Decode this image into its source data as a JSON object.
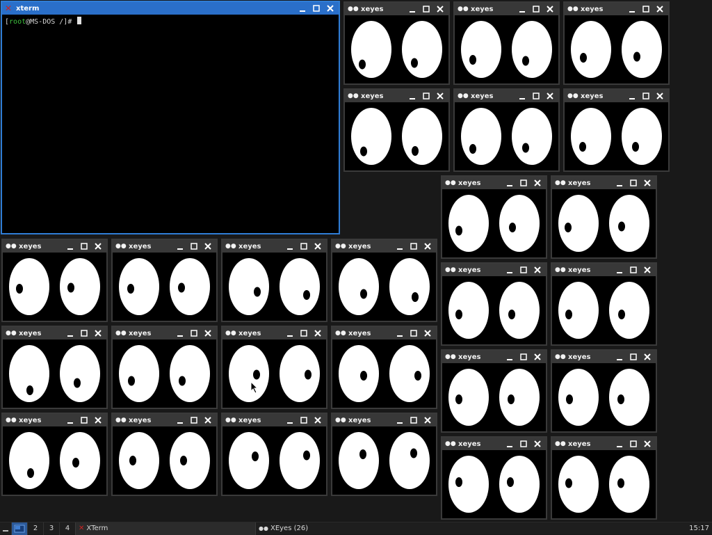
{
  "xterm": {
    "title": "xterm",
    "prompt_open": "[",
    "prompt_user": "root",
    "prompt_rest": "@MS-DOS /]# "
  },
  "xeyes": {
    "title": "xeyes",
    "instances": [
      {
        "lp": [
          -0.65,
          0.72
        ],
        "rp": [
          -0.55,
          0.65
        ]
      },
      {
        "lp": [
          -0.6,
          0.5
        ],
        "rp": [
          -0.45,
          0.55
        ]
      },
      {
        "lp": [
          -0.55,
          0.4
        ],
        "rp": [
          -0.35,
          0.35
        ]
      },
      {
        "lp": [
          -0.55,
          0.72
        ],
        "rp": [
          -0.5,
          0.7
        ]
      },
      {
        "lp": [
          -0.6,
          0.6
        ],
        "rp": [
          -0.45,
          0.55
        ]
      },
      {
        "lp": [
          -0.6,
          0.5
        ],
        "rp": [
          -0.45,
          0.5
        ]
      },
      {
        "lp": [
          -0.7,
          0.35
        ],
        "rp": [
          -0.5,
          0.2
        ]
      },
      {
        "lp": [
          -0.75,
          0.2
        ],
        "rp": [
          -0.55,
          0.15
        ]
      },
      {
        "lp": [
          -0.7,
          0.2
        ],
        "rp": [
          -0.55,
          0.2
        ]
      },
      {
        "lp": [
          -0.7,
          0.2
        ],
        "rp": [
          -0.55,
          0.2
        ]
      },
      {
        "lp": [
          -0.7,
          0.1
        ],
        "rp": [
          -0.6,
          0.1
        ]
      },
      {
        "lp": [
          -0.65,
          0.1
        ],
        "rp": [
          -0.6,
          0.1
        ]
      },
      {
        "lp": [
          -0.7,
          -0.1
        ],
        "rp": [
          -0.65,
          -0.1
        ]
      },
      {
        "lp": [
          -0.7,
          -0.05
        ],
        "rp": [
          -0.6,
          -0.05
        ]
      },
      {
        "lp": [
          -0.7,
          0.1
        ],
        "rp": [
          -0.65,
          0.05
        ]
      },
      {
        "lp": [
          -0.6,
          0.1
        ],
        "rp": [
          -0.6,
          0.05
        ]
      },
      {
        "lp": [
          0.6,
          0.25
        ],
        "rp": [
          0.5,
          0.4
        ]
      },
      {
        "lp": [
          0.35,
          0.35
        ],
        "rp": [
          0.4,
          0.5
        ]
      },
      {
        "lp": [
          0.05,
          0.8
        ],
        "rp": [
          -0.2,
          0.45
        ]
      },
      {
        "lp": [
          -0.55,
          0.35
        ],
        "rp": [
          -0.55,
          0.35
        ]
      },
      {
        "lp": [
          0.55,
          0.05
        ],
        "rp": [
          0.6,
          0.05
        ]
      },
      {
        "lp": [
          0.35,
          0.1
        ],
        "rp": [
          0.6,
          0.1
        ]
      },
      {
        "lp": [
          0.1,
          0.6
        ],
        "rp": [
          -0.3,
          0.1
        ]
      },
      {
        "lp": [
          -0.45,
          0.0
        ],
        "rp": [
          -0.45,
          0.0
        ]
      },
      {
        "lp": [
          0.45,
          -0.2
        ],
        "rp": [
          0.5,
          -0.25
        ]
      },
      {
        "lp": [
          0.3,
          -0.3
        ],
        "rp": [
          0.3,
          -0.35
        ]
      }
    ]
  },
  "taskbar": {
    "workspaces": [
      "",
      "2",
      "3",
      "4"
    ],
    "task_xterm": "XTerm",
    "task_xeyes": "XEyes (26)",
    "clock": "15:17"
  },
  "colors": {
    "desktop": "#191919",
    "active_title": "#2a6fc9",
    "inactive_title": "#383838"
  }
}
